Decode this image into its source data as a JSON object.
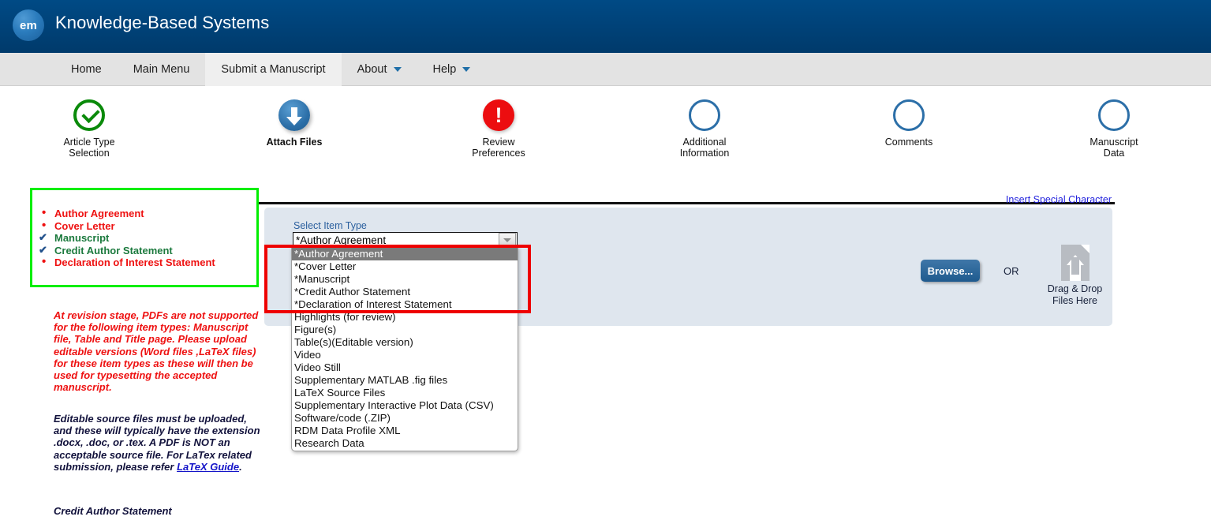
{
  "header": {
    "logo_text": "em",
    "title": "Knowledge-Based Systems",
    "bg_color": "#00467f"
  },
  "nav": {
    "items": [
      {
        "label": "Home",
        "active": false,
        "has_caret": false
      },
      {
        "label": "Main Menu",
        "active": false,
        "has_caret": false
      },
      {
        "label": "Submit a Manuscript",
        "active": true,
        "has_caret": false
      },
      {
        "label": "About",
        "active": false,
        "has_caret": true
      },
      {
        "label": "Help",
        "active": false,
        "has_caret": true
      }
    ]
  },
  "stepper": {
    "steps": [
      {
        "label": "Article Type\nSelection",
        "line1": "Article Type",
        "line2": "Selection",
        "state": "done"
      },
      {
        "label": "Attach Files",
        "line1": "Attach Files",
        "line2": "",
        "state": "current"
      },
      {
        "label": "Review\nPreferences",
        "line1": "Review",
        "line2": "Preferences",
        "state": "error"
      },
      {
        "label": "Additional\nInformation",
        "line1": "Additional",
        "line2": "Information",
        "state": "pending"
      },
      {
        "label": "Comments",
        "line1": "Comments",
        "line2": "",
        "state": "pending"
      },
      {
        "label": "Manuscript\nData",
        "line1": "Manuscript",
        "line2": "Data",
        "state": "pending"
      }
    ]
  },
  "checklist": {
    "border_color": "#00ee00",
    "items": [
      {
        "label": "Author Agreement",
        "status": "pending"
      },
      {
        "label": "Cover Letter",
        "status": "pending"
      },
      {
        "label": "Manuscript",
        "status": "checked"
      },
      {
        "label": "Credit Author Statement",
        "status": "checked"
      },
      {
        "label": "Declaration of Interest Statement",
        "status": "pending"
      }
    ]
  },
  "notes": {
    "warning_red": "At revision stage, PDFs are not supported for the following item types: Manuscript file, Table and Title page. Please upload editable versions (Word files ,LaTeX files) for these item types as these will then be used for typesetting the accepted manuscript.",
    "editable_note_part1": "Editable source files must be uploaded, and these will typically have the extension .docx, .doc, or .tex. A PDF is NOT an acceptable source file. For LaTex related submission, please refer ",
    "editable_note_link": "LaTeX Guide",
    "editable_note_part2": ".",
    "credit_author_statement_heading": "Credit Author Statement"
  },
  "upload_panel": {
    "insert_special_character": "Insert Special Character",
    "select_item_type_label": "Select Item Type",
    "selected_item_type": "*Author Agreement",
    "browse_label": "Browse...",
    "or_label": "OR",
    "dropzone_line1": "Drag & Drop",
    "dropzone_line2": "Files Here",
    "panel_color": "#dfe6ee"
  },
  "dropdown": {
    "open": true,
    "selected_index": 0,
    "options": [
      "*Author Agreement",
      "*Cover Letter",
      "*Manuscript",
      "*Credit Author Statement",
      "*Declaration of Interest Statement",
      "Highlights (for review)",
      "Figure(s)",
      "Table(s)(Editable version)",
      "Video",
      "Video Still",
      "Supplementary MATLAB .fig files",
      "LaTeX Source Files",
      "Supplementary Interactive Plot Data (CSV)",
      "Software/code (.ZIP)",
      "RDM Data Profile XML",
      "Research Data"
    ]
  },
  "annotations": {
    "red_highlight_color": "#ee0000",
    "green_highlight_color": "#00ee00"
  }
}
